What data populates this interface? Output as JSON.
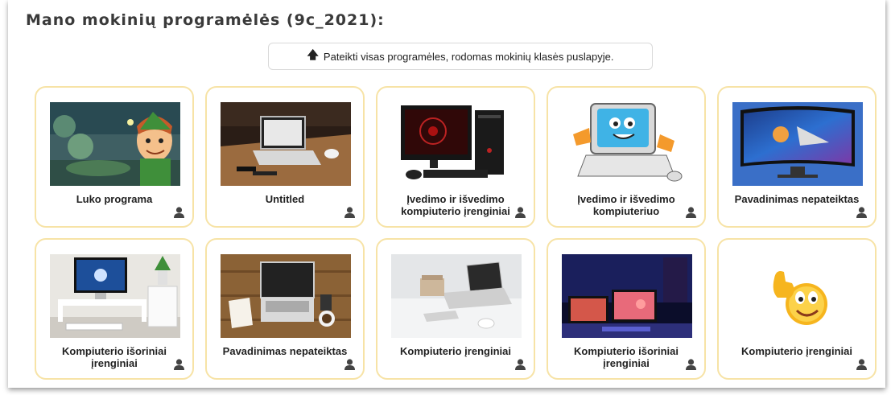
{
  "page": {
    "heading": "Mano mokinių programėlės (9c_2021):",
    "submit_button": "Pateikti visas programėles, rodomas mokinių klasės puslapyje.",
    "submit_icon": "arrow-up-icon"
  },
  "colors": {
    "card_border": "#f7e3a6",
    "text": "#222222"
  },
  "cards": [
    {
      "title": "Luko programa",
      "image": "peter-pan-cartoon",
      "icon": "user-icon"
    },
    {
      "title": "Untitled",
      "image": "laptop-on-wooden-table",
      "icon": "user-icon"
    },
    {
      "title": "Įvedimo ir išvedimo kompiuterio įrenginiai",
      "image": "desktop-computer-tower",
      "icon": "user-icon"
    },
    {
      "title": "Įvedimo ir išvedimo kompiuteriuo",
      "image": "cartoon-computer-thumbs-up",
      "icon": "user-icon"
    },
    {
      "title": "Pavadinimas nepateiktas",
      "image": "curved-monitor-space",
      "icon": "user-icon"
    },
    {
      "title": "Kompiuterio išoriniai įrenginiai",
      "image": "imac-desk-with-plant",
      "icon": "user-icon"
    },
    {
      "title": "Pavadinimas nepateiktas",
      "image": "laptop-notebook-coffee",
      "icon": "user-icon"
    },
    {
      "title": "Kompiuterio įrenginiai",
      "image": "laptop-white-desk",
      "icon": "user-icon"
    },
    {
      "title": "Kompiuterio išoriniai įrenginiai",
      "image": "gaming-setup-neon",
      "icon": "user-icon"
    },
    {
      "title": "Kompiuterio įrenginiai",
      "image": "thumbs-up-emoji",
      "icon": "user-icon"
    }
  ]
}
